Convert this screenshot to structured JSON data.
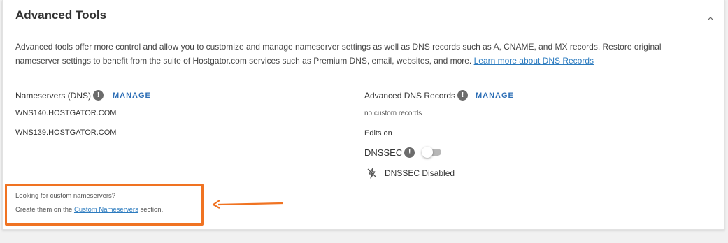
{
  "panel": {
    "title": "Advanced Tools",
    "description": "Advanced tools offer more control and allow you to customize and manage nameserver settings as well as DNS records such as A, CNAME, and MX records. Restore original nameserver settings to benefit from the suite of Hostgator.com services such as Premium DNS, email, websites, and more.",
    "learn_more_link": "Learn more about DNS Records"
  },
  "nameservers": {
    "label": "Nameservers (DNS)",
    "info_icon": "!",
    "manage_label": "MANAGE",
    "items": [
      "WNS140.HOSTGATOR.COM",
      "WNS139.HOSTGATOR.COM"
    ]
  },
  "dns_records": {
    "label": "Advanced DNS Records",
    "info_icon": "!",
    "manage_label": "MANAGE",
    "status": "no custom records",
    "edits": "Edits on"
  },
  "dnssec": {
    "label": "DNSSEC",
    "info_icon": "!",
    "toggle_on": false,
    "status_text": "DNSSEC Disabled"
  },
  "custom_ns": {
    "question": "Looking for custom nameservers?",
    "prefix": "Create them on the ",
    "link": "Custom Nameservers",
    "suffix": " section."
  },
  "colors": {
    "link": "#2c7bbf",
    "manage": "#2e6fb6",
    "callout": "#f07322",
    "toggle_off": "#b7b7b7"
  },
  "icons": {
    "collapse": "chevron-up-icon",
    "info": "info-icon",
    "dnssec_disabled": "lightning-off-icon"
  }
}
